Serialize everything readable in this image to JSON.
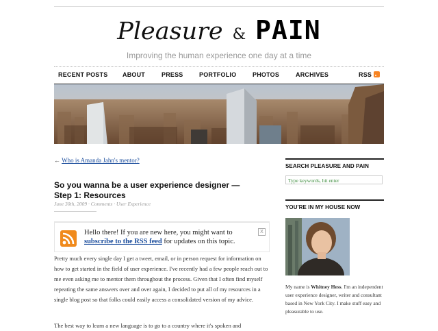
{
  "site": {
    "title_part1": "Pleasure",
    "title_amp": "&",
    "title_part2": "PAIN",
    "tagline": "Improving the human experience one day at a time"
  },
  "nav": {
    "items": [
      "RECENT POSTS",
      "ABOUT",
      "PRESS",
      "PORTFOLIO",
      "PHOTOS",
      "ARCHIVES"
    ],
    "rss_label": "RSS"
  },
  "breadcrumb": {
    "arrow": "←",
    "prev_link": "Who is Amanda Jahn's mentor?"
  },
  "post": {
    "title": "So you wanna be a user experience designer — Step 1: Resources",
    "meta": "June 30th, 2009 · Comments · User Experience",
    "rss_box": {
      "text_before": "Hello there! If you are new here, you might want to",
      "link": "subscribe to the RSS feed",
      "text_after": "for updates on this topic.",
      "close": "X"
    },
    "paragraph1": "Pretty much every single day I get a tweet, email, or in person request for information on how to get started in the field of user experience. I've recently had a few people reach out to me even asking me to mentor them throughout the process. Given that I often find myself repeating the same answers over and over again, I decided to put all of my resources in a single blog post so that folks could easily access a consolidated version of my advice.",
    "paragraph2": "The best way to learn a new language is to go to a country where it's spoken and"
  },
  "sidebar": {
    "search_heading": "SEARCH PLEASURE AND PAIN",
    "search_placeholder": "Type keywords, hit enter",
    "about_heading": "YOU'RE IN MY HOUSE NOW",
    "bio_prefix": "My name is",
    "bio_name": "Whitney Hess",
    "bio_rest": ". I'm an independent user experience designer, writer and consultant based in New York City. I make stuff easy and pleasurable to use."
  },
  "colors": {
    "link": "#1a4c9c",
    "rss": "#f08a1c",
    "search_text": "#3a8a3a"
  }
}
